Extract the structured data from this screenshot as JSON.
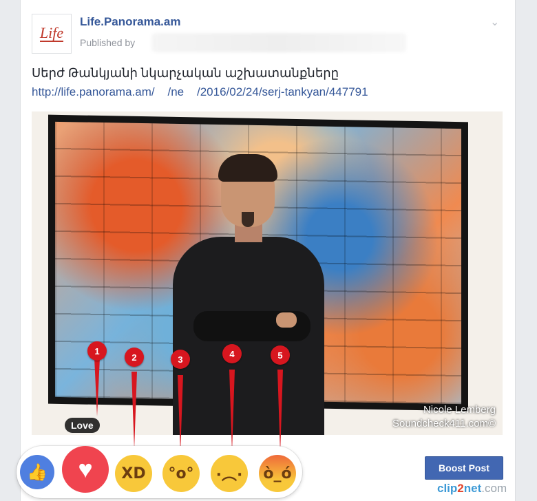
{
  "post": {
    "page_name": "Life.Panorama.am",
    "logo_text": "Life",
    "published_label": "Published by",
    "text": "Սերժ Թանկյանի նկարչական աշխատանքները",
    "link": "http://life.panorama.am/    /ne    /2016/02/24/serj-tankyan/447791"
  },
  "photo": {
    "watermark_line1": "Nicole Lemberg",
    "watermark_line2": "Soundcheck411.com©"
  },
  "reactions": {
    "tooltip": "Love",
    "items": [
      {
        "name": "Like",
        "icon": "thumbs-up-icon",
        "glyph": "👍"
      },
      {
        "name": "Love",
        "icon": "heart-icon",
        "glyph": "♥"
      },
      {
        "name": "Haha",
        "icon": "laughing-face-icon",
        "glyph": "XD"
      },
      {
        "name": "Wow",
        "icon": "surprised-face-icon",
        "glyph": "°o°"
      },
      {
        "name": "Sad",
        "icon": "sad-face-icon",
        "glyph": "·︵·"
      },
      {
        "name": "Angry",
        "icon": "angry-face-icon",
        "glyph": "ò_ó"
      }
    ]
  },
  "annotations": [
    "1",
    "2",
    "3",
    "4",
    "5"
  ],
  "actions": {
    "boost_label": "Boost Post"
  },
  "branding": {
    "part1": "clip",
    "part2": "2",
    "part3": "net",
    "part4": ".com"
  },
  "colors": {
    "accent": "#4267b2",
    "love": "#f0444f",
    "pin": "#d7161f",
    "link": "#365899"
  }
}
